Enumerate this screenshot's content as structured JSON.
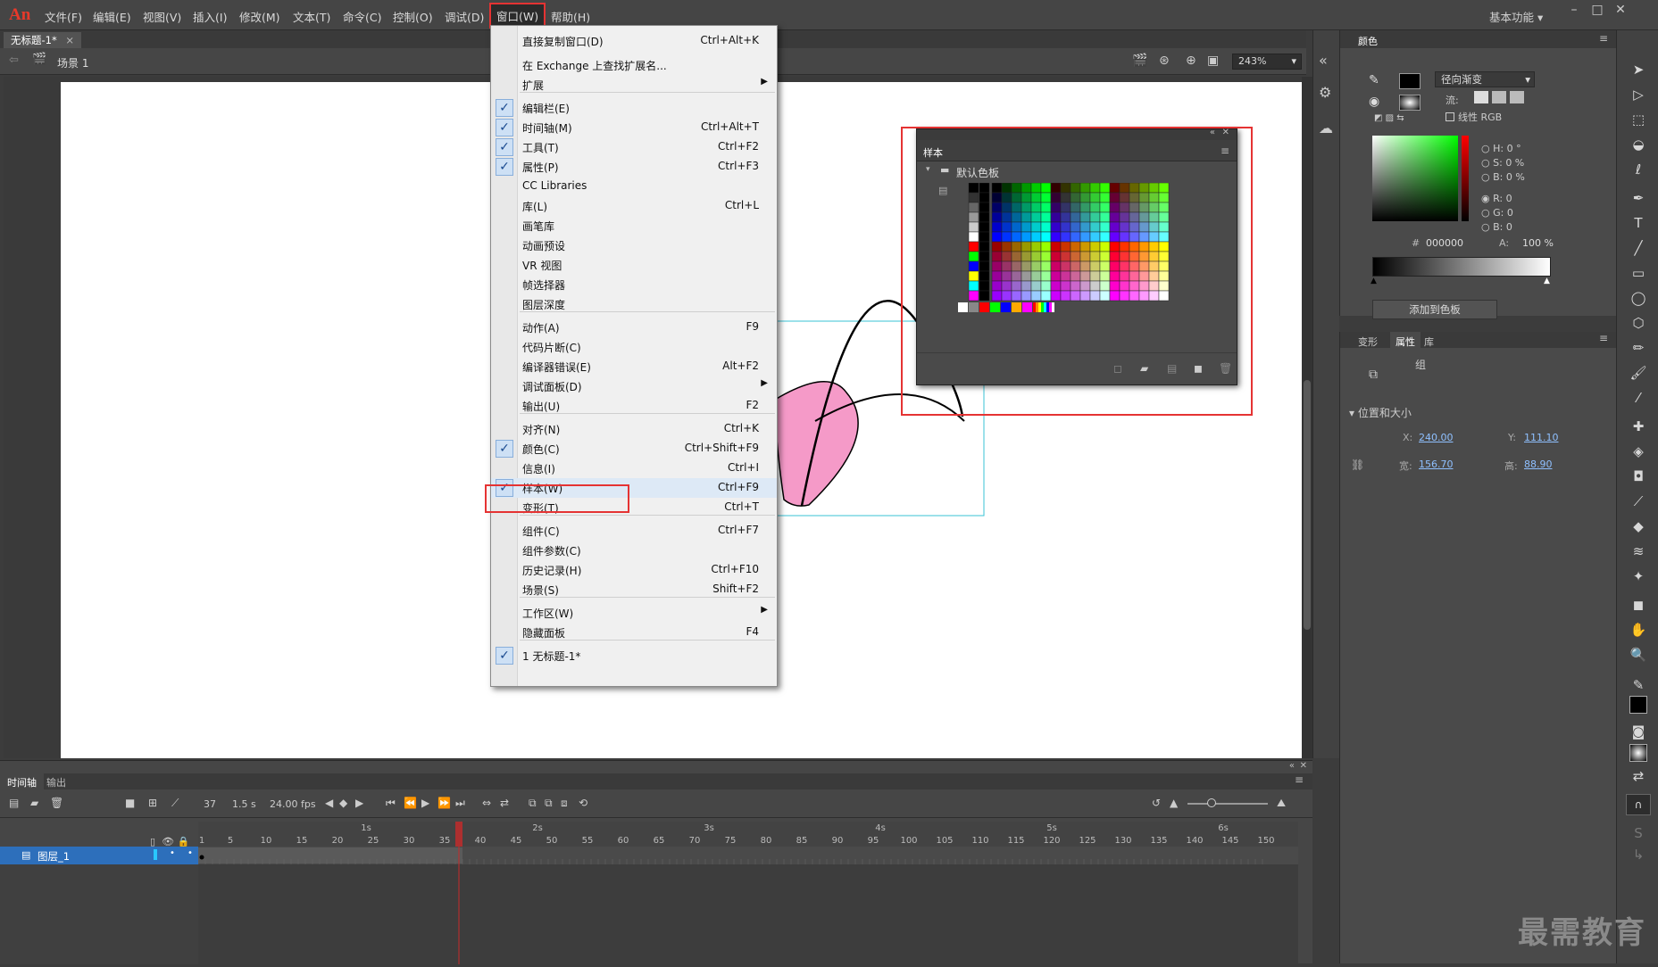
{
  "menubar": {
    "logo": "An",
    "items": [
      "文件(F)",
      "编辑(E)",
      "视图(V)",
      "插入(I)",
      "修改(M)",
      "文本(T)",
      "命令(C)",
      "控制(O)",
      "调试(D)",
      "窗口(W)",
      "帮助(H)"
    ],
    "workspace": "基本功能 ▾"
  },
  "document": {
    "tab": "无标题-1*",
    "tab_close": "×",
    "scene": "场景 1",
    "zoom": "243%"
  },
  "window_menu": {
    "items": [
      {
        "label": "直接复制窗口(D)",
        "shortcut": "Ctrl+Alt+K",
        "checked": false
      },
      {
        "label": "在 Exchange 上查找扩展名...",
        "shortcut": "",
        "checked": false
      },
      {
        "label": "扩展",
        "shortcut": "",
        "checked": false,
        "submenu": true
      },
      {
        "label": "编辑栏(E)",
        "shortcut": "",
        "checked": true
      },
      {
        "label": "时间轴(M)",
        "shortcut": "Ctrl+Alt+T",
        "checked": true
      },
      {
        "label": "工具(T)",
        "shortcut": "Ctrl+F2",
        "checked": true
      },
      {
        "label": "属性(P)",
        "shortcut": "Ctrl+F3",
        "checked": true
      },
      {
        "label": "CC Libraries",
        "shortcut": "",
        "checked": false
      },
      {
        "label": "库(L)",
        "shortcut": "Ctrl+L",
        "checked": false
      },
      {
        "label": "画笔库",
        "shortcut": "",
        "checked": false
      },
      {
        "label": "动画预设",
        "shortcut": "",
        "checked": false
      },
      {
        "label": "VR 视图",
        "shortcut": "",
        "checked": false
      },
      {
        "label": "帧选择器",
        "shortcut": "",
        "checked": false
      },
      {
        "label": "图层深度",
        "shortcut": "",
        "checked": false
      },
      {
        "label": "动作(A)",
        "shortcut": "F9",
        "checked": false
      },
      {
        "label": "代码片断(C)",
        "shortcut": "",
        "checked": false
      },
      {
        "label": "编译器错误(E)",
        "shortcut": "Alt+F2",
        "checked": false
      },
      {
        "label": "调试面板(D)",
        "shortcut": "",
        "checked": false,
        "submenu": true
      },
      {
        "label": "输出(U)",
        "shortcut": "F2",
        "checked": false
      },
      {
        "label": "对齐(N)",
        "shortcut": "Ctrl+K",
        "checked": false
      },
      {
        "label": "颜色(C)",
        "shortcut": "Ctrl+Shift+F9",
        "checked": true
      },
      {
        "label": "信息(I)",
        "shortcut": "Ctrl+I",
        "checked": false
      },
      {
        "label": "样本(W)",
        "shortcut": "Ctrl+F9",
        "checked": true
      },
      {
        "label": "变形(T)",
        "shortcut": "Ctrl+T",
        "checked": false
      },
      {
        "label": "组件(C)",
        "shortcut": "Ctrl+F7",
        "checked": false
      },
      {
        "label": "组件参数(C)",
        "shortcut": "",
        "checked": false
      },
      {
        "label": "历史记录(H)",
        "shortcut": "Ctrl+F10",
        "checked": false
      },
      {
        "label": "场景(S)",
        "shortcut": "Shift+F2",
        "checked": false
      },
      {
        "label": "工作区(W)",
        "shortcut": "",
        "checked": false,
        "submenu": true
      },
      {
        "label": "隐藏面板",
        "shortcut": "F4",
        "checked": false
      },
      {
        "label": "1 无标题-1*",
        "shortcut": "",
        "checked": true
      }
    ]
  },
  "swatches": {
    "tab": "样本",
    "folder": "默认色板"
  },
  "color_panel": {
    "tab": "颜色",
    "fill_type": "径向渐变",
    "flow": "流:",
    "linear_rgb": "线性 RGB",
    "h": {
      "label": "H:",
      "value": "0 °"
    },
    "s": {
      "label": "S:",
      "value": "0 %"
    },
    "b": {
      "label": "B:",
      "value": "0 %"
    },
    "r": {
      "label": "R:",
      "value": "0"
    },
    "g": {
      "label": "G:",
      "value": "0"
    },
    "bl": {
      "label": "B:",
      "value": "0"
    },
    "hex": "000000",
    "hex_label": "#",
    "alpha": {
      "label": "A:",
      "value": "100 %"
    },
    "add_swatch": "添加到色板"
  },
  "properties": {
    "tabs": [
      "变形",
      "属性",
      "库"
    ],
    "object": "组",
    "section": "位置和大小",
    "x": {
      "label": "X:",
      "value": "240.00"
    },
    "y": {
      "label": "Y:",
      "value": "111.10"
    },
    "w": {
      "label": "宽:",
      "value": "156.70"
    },
    "h": {
      "label": "高:",
      "value": "88.90"
    }
  },
  "timeline": {
    "tabs": [
      "时间轴",
      "输出"
    ],
    "frame": "37",
    "time": "1.5 s",
    "fps": "24.00 fps",
    "layer": "图层_1",
    "seconds": [
      "1s",
      "2s",
      "3s",
      "4s",
      "5s",
      "6s"
    ],
    "frame_ticks": [
      "1",
      "5",
      "10",
      "15",
      "20",
      "25",
      "30",
      "35",
      "40",
      "45",
      "50",
      "55",
      "60",
      "65",
      "70",
      "75",
      "80",
      "85",
      "90",
      "95",
      "100",
      "105",
      "110",
      "115",
      "120",
      "125",
      "130",
      "135",
      "140",
      "145",
      "150"
    ]
  },
  "watermark": "最需教育",
  "colors": {
    "accent_red": "#e53333",
    "stage_bg": "#ffffff",
    "shape_fill": "#f59ac8",
    "layer_highlight": "#2d6fbb"
  }
}
